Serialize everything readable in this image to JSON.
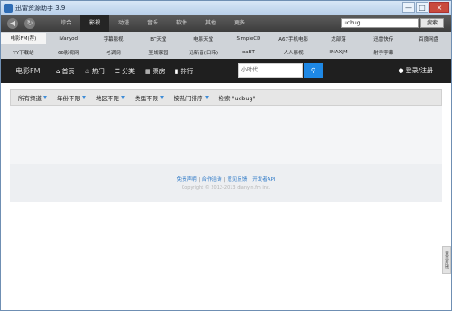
{
  "window": {
    "title": "迅雷资源助手 3.9"
  },
  "window_controls": {
    "minimize": "—",
    "maximize": "□",
    "close": "×"
  },
  "toolbar": {
    "back": "◀",
    "refresh": "↻",
    "tabs": [
      "综合",
      "影视",
      "动漫",
      "音乐",
      "软件",
      "其他",
      "更多"
    ],
    "active_tab": "影视",
    "search_value": "ucbug",
    "search_button": "搜索"
  },
  "sites": {
    "row1": [
      "电影FM(荐)",
      "iVaryod",
      "字幕影视",
      "BT天堂",
      "电影天堂",
      "SimpleCD",
      "A67手机电影",
      "龙部落",
      "迅雷快传",
      "百度网盘"
    ],
    "row2": [
      "YY下载站",
      "66影视网",
      "老调网",
      "圣城家园",
      "迅新音(日韩)",
      "oaBT",
      "人人影视",
      "IMAXJM",
      "射手字幕",
      ""
    ],
    "active": "电影FM(荐)"
  },
  "nav": {
    "brand": "电影FM",
    "items": [
      {
        "icon": "home-icon",
        "glyph": "⌂",
        "label": "首页"
      },
      {
        "icon": "fire-icon",
        "glyph": "♨",
        "label": "热门"
      },
      {
        "icon": "list-icon",
        "glyph": "☰",
        "label": "分类"
      },
      {
        "icon": "film-icon",
        "glyph": "▦",
        "label": "票房"
      },
      {
        "icon": "chart-icon",
        "glyph": "▮",
        "label": "排行"
      }
    ],
    "search_placeholder": "小时代",
    "search_icon": "⚲",
    "login_icon": "●",
    "login": "登录/注册"
  },
  "filters": {
    "items": [
      "所有频道",
      "年份不限",
      "地区不限",
      "类型不限",
      "按热门排序"
    ],
    "keyword": "检索 \"ucbug\""
  },
  "footer": {
    "links": [
      "免责声明",
      "合作洽询",
      "意见反馈",
      "开发者API"
    ],
    "copyright": "Copyright © 2012-2013 dianyin.fm inc."
  },
  "sidebar_tab": "意见反馈"
}
